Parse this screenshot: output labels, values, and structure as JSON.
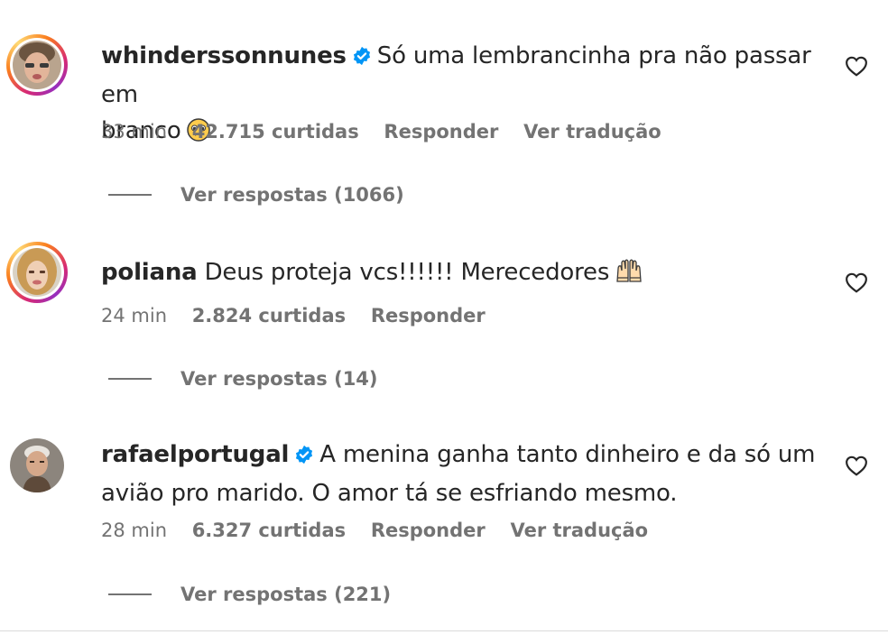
{
  "comments": [
    {
      "username": "whinderssonnunes",
      "verified": true,
      "text_line1": "Só uma lembrancinha pra não passar em",
      "text_line2": "branco",
      "emoji": "pleading-face-icon",
      "time": "33 min",
      "likes": "42.715 curtidas",
      "reply": "Responder",
      "translate": "Ver tradução",
      "view_replies": "Ver respostas (1066)",
      "story_ring": true
    },
    {
      "username": "poliana",
      "verified": false,
      "text_line1": "Deus proteja vcs!!!!!! Merecedores",
      "emoji": "raising-hands-icon",
      "time": "24 min",
      "likes": "2.824 curtidas",
      "reply": "Responder",
      "view_replies": "Ver respostas (14)",
      "story_ring": true
    },
    {
      "username": "rafaelportugal",
      "verified": true,
      "text_line1": "A menina ganha tanto dinheiro e da só um",
      "text_line2": "avião pro marido. O amor tá se esfriando mesmo.",
      "time": "28 min",
      "likes": "6.327 curtidas",
      "reply": "Responder",
      "translate": "Ver tradução",
      "view_replies": "Ver respostas (221)",
      "story_ring": false
    }
  ],
  "colors": {
    "text": "#262626",
    "secondary": "#737373",
    "verified": "#0095f6"
  }
}
